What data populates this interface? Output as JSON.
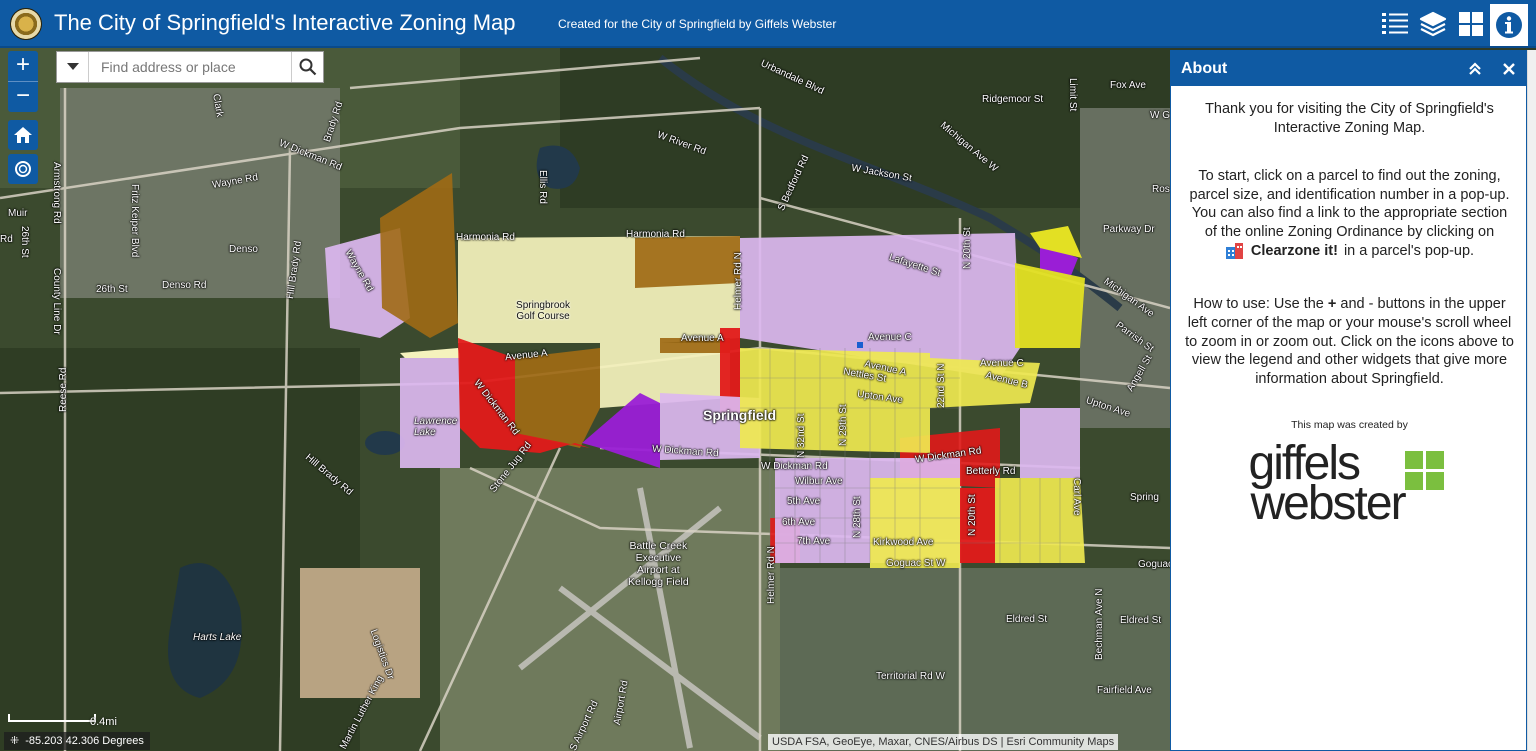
{
  "header": {
    "title": "The City of Springfield's Interactive Zoning Map",
    "subtitle": "Created for the City of Springfield by Giffels Webster",
    "buttons": [
      {
        "name": "legend",
        "icon": "list-icon",
        "active": false
      },
      {
        "name": "layers",
        "icon": "layers-icon",
        "active": false
      },
      {
        "name": "basemap",
        "icon": "grid-icon",
        "active": false
      },
      {
        "name": "about",
        "icon": "info-icon",
        "active": true
      }
    ],
    "colors": {
      "bar": "#0f5aa3",
      "text": "#ffffff"
    }
  },
  "search": {
    "placeholder": "Find address or place"
  },
  "map": {
    "labels": {
      "springfield": "Springfield",
      "golf": "Springbrook\nGolf Course",
      "lawrence_lake": "Lawrence\nLake",
      "harts_lake": "Harts Lake",
      "airport": "Battle Creek\nExecutive\nAirport at\nKellogg Field",
      "denso": "Denso",
      "harmonia_rd_1": "Harmonia Rd",
      "harmonia_rd_2": "Harmonia Rd",
      "avenue_a": "Avenue A",
      "avenue_a_2": "Avenue A",
      "avenue_a_3": "Avenue A",
      "avenue_c": "Avenue C",
      "avenue_b": "Avenue B",
      "avenue_c_2": "Avenue C",
      "w_dickman_rd_1": "W Dickman Rd",
      "w_dickman_rd_2": "W Dickman Rd",
      "w_dickman_rd_3": "W Dickman Rd",
      "w_dickman_rd_4": "W Dickman Rd",
      "w_dickman_rd_5": "W Dickman Rd",
      "wayne_rd": "Wayne Rd",
      "wayne_rd_2": "Wayne Rd",
      "26th_st": "26th St",
      "denso_rd": "Denso Rd",
      "w_river_rd": "W River Rd",
      "w_jackson_st": "W Jackson St",
      "urbandale": "Urbandale Blvd",
      "ridgemoor": "Ridgemoor St",
      "fox_ave": "Fox Ave",
      "parkway_dr": "Parkway Dr",
      "lafayette": "Lafayette St",
      "nettles": "Nettles St",
      "upton_ave": "Upton Ave",
      "upton_ave_2": "Upton Ave",
      "betterly": "Betterly Rd",
      "wilbur": "Wilbur Ave",
      "5th_ave": "5th Ave",
      "6th_ave": "6th Ave",
      "7th_ave": "7th Ave",
      "kirkwood": "Kirkwood Ave",
      "goguac": "Goguac St W",
      "goguac_2": "Goguac",
      "eldred": "Eldred St",
      "eldred_2": "Eldred St",
      "territorial": "Territorial Rd W",
      "fairfield": "Fairfield Ave",
      "stone_jug": "Stone Jug Rd",
      "hill_brady": "Hill Brady Rd",
      "hill_brady_2": "Hill Brady Rd",
      "ellis": "Ellis Rd",
      "brady": "Brady Rd",
      "clark": "Clark",
      "armstrong": "Armstrong Rd",
      "fritz": "Fritz Keiper Blvd",
      "county_line": "County Line Dr",
      "reese": "Reese Rd",
      "helmer_rd_n": "Helmer Rd N",
      "helmer_rd_n_2": "Helmer Rd N",
      "bedford": "S Bedford Rd",
      "michigan_ave_w": "Michigan Ave W",
      "michigan_ave": "Michigan Ave",
      "limit_st": "Limit St",
      "parrish": "Parrish St",
      "angell": "Angell St",
      "carl": "Carl Ave",
      "springf": "Spring",
      "logistics": "Logistics Dr",
      "mlk": "Martin Luther King",
      "s_airport": "S Airport Rd",
      "airport_rd": "Airport Rd",
      "n_20th": "N 20th St",
      "n_20th_2": "N 20th St",
      "n_22nd": "22nd St N",
      "n_32nd": "N 32nd St",
      "n_29th": "N 29th St",
      "n_28th": "N 28th St",
      "bechman": "Bechman Ave N",
      "muir": "Muir",
      "26th_st_v": "26th St",
      "rd": "Rd",
      "ros": "Ros",
      "w_g": "W G",
      "clear_label": "Clearzone it!"
    }
  },
  "controls": {
    "zoom_in": "+",
    "zoom_out": "−",
    "home_icon": "home-icon",
    "locate_icon": "locate-icon"
  },
  "scale": {
    "label": "0.4mi"
  },
  "coordinates": {
    "text": "-85.203 42.306 Degrees"
  },
  "attribution": "USDA FSA, GeoEye, Maxar, CNES/Airbus DS | Esri Community Maps",
  "about": {
    "title": "About",
    "p1": "Thank you for visiting the City of Springfield's Interactive Zoning Map.",
    "p2": "To start, click on a parcel to find out the zoning, parcel size, and identification number in a pop-up. You can also find a link to the appropriate section of the online Zoning Ordinance by clicking on",
    "clearzone": "Clearzone it!",
    "p2_end": "in a parcel's pop-up.",
    "p3_a": "How to use: Use the",
    "p3_plus": "+",
    "p3_b": "and - buttons in the upper left corner of the map or your mouse's scroll wheel to zoom in or zoom out. Click on the icons above to view the legend and other widgets that give more information about Springfield.",
    "credit": "This map was created by",
    "logo_word_1": "giffels",
    "logo_word_2": "webster",
    "logo_color": "#7bbf3f"
  }
}
